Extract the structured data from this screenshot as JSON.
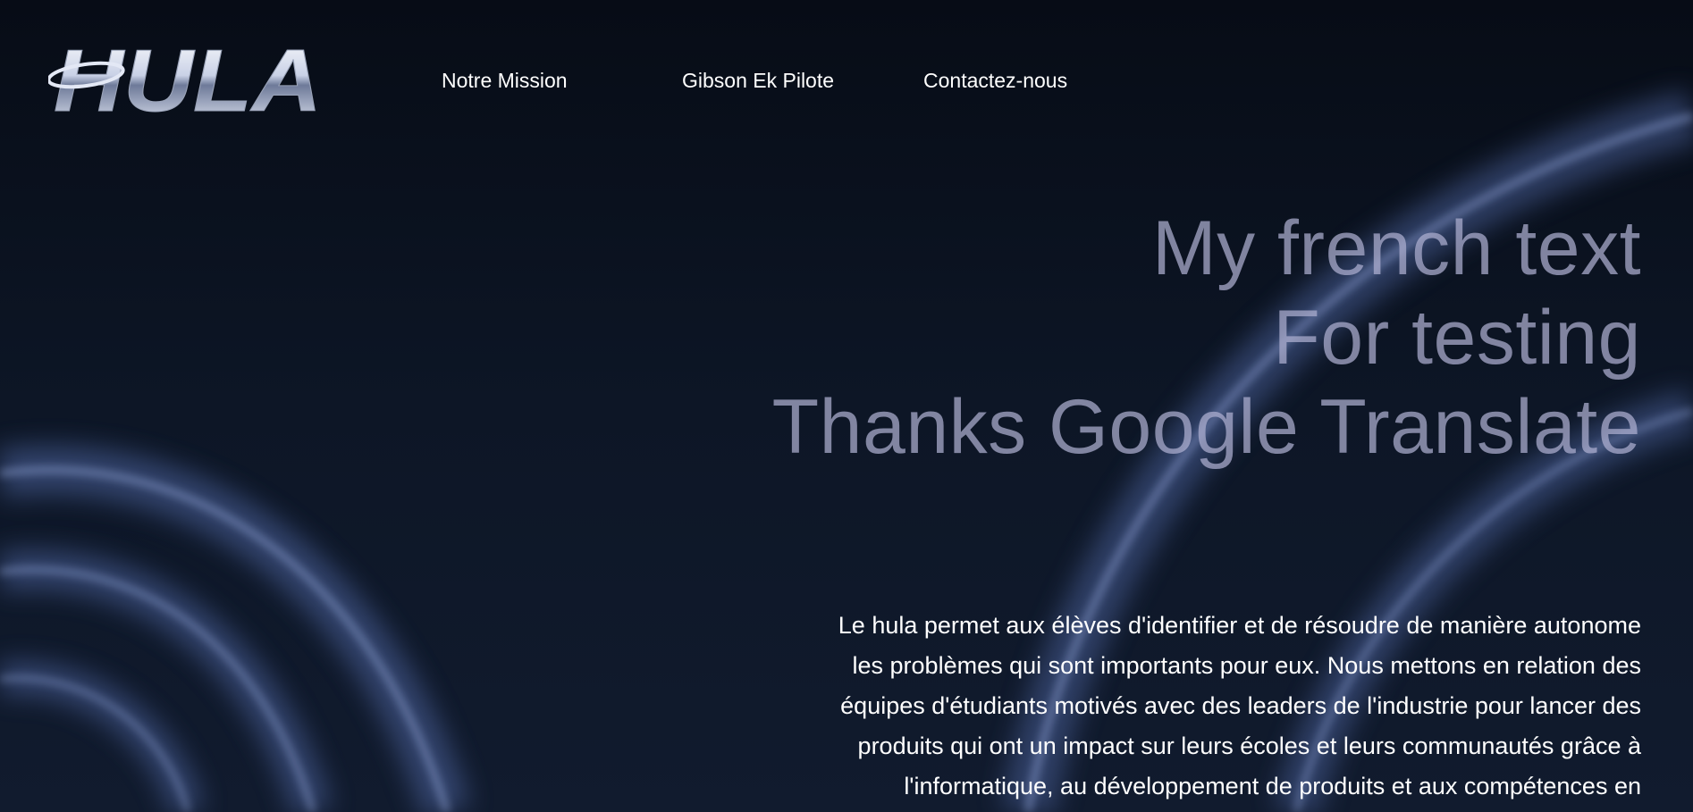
{
  "brand": {
    "logo_text": "HULA"
  },
  "nav": {
    "items": [
      {
        "label": "Notre Mission"
      },
      {
        "label": "Gibson Ek Pilote"
      },
      {
        "label": "Contactez-nous"
      }
    ]
  },
  "hero": {
    "lines": [
      "My french text",
      "For testing",
      "Thanks Google Translate"
    ]
  },
  "description": {
    "lines": [
      "Le hula permet aux élèves d'identifier et de résoudre de manière autonome",
      "les problèmes qui sont importants pour eux. Nous mettons en relation des",
      "équipes d'étudiants motivés avec des leaders de l'industrie pour lancer des",
      "produits qui ont un impact sur leurs écoles et leurs communautés grâce à",
      "l'informatique, au développement de produits et aux compétences en"
    ]
  },
  "colors": {
    "background": "#0b1220",
    "wave_glow": "#5a6fa6",
    "hero_text": "#afb0d1",
    "body_text": "#ffffff"
  }
}
